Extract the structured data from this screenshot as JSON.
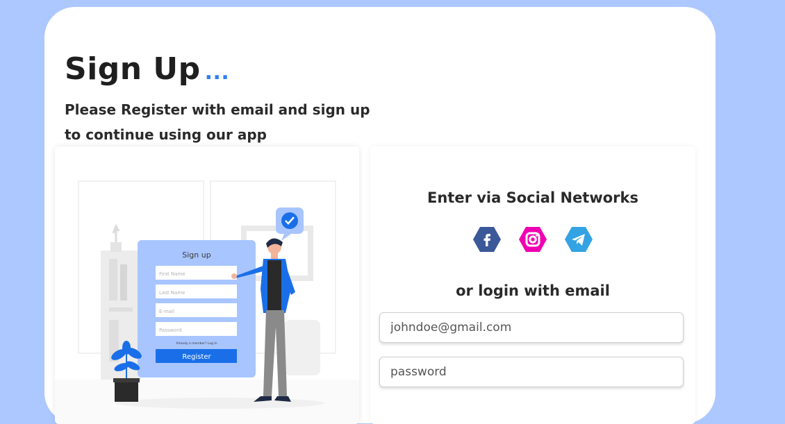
{
  "header": {
    "title": "Sign Up",
    "title_dots": "...",
    "subtitle": "Please Register with email and sign up to continue using our app"
  },
  "illustration": {
    "form_title": "Sign up",
    "fields": [
      "First Name",
      "Last Name",
      "E-mail",
      "Password"
    ],
    "member_text": "Already a member? Log In",
    "register_label": "Register"
  },
  "social": {
    "title": "Enter via Social Networks",
    "icons": [
      "facebook-icon",
      "instagram-icon",
      "telegram-icon"
    ],
    "colors": {
      "facebook": "#3b5998",
      "instagram": "#f000b0",
      "telegram": "#34a3e3"
    }
  },
  "login": {
    "title": "or login with email",
    "email_placeholder": "johndoe@gmail.com",
    "password_placeholder": "password"
  },
  "colors": {
    "background": "#adc8ff",
    "accent": "#2f80ed",
    "card": "#ffffff"
  }
}
